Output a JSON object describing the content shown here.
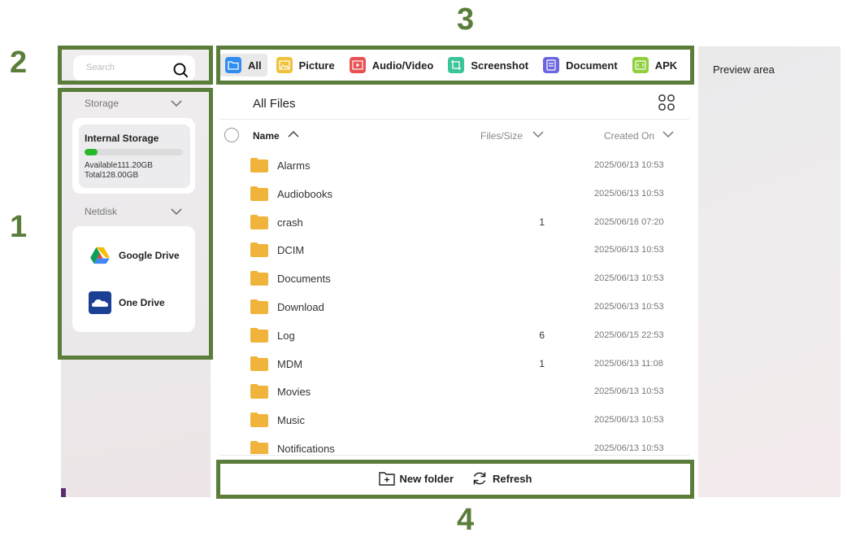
{
  "callouts": {
    "n1": "1",
    "n2": "2",
    "n3": "3",
    "n4": "4"
  },
  "search": {
    "placeholder": "Search"
  },
  "sidebar": {
    "storage_header": "Storage",
    "storage": {
      "name": "Internal Storage",
      "used_fraction": 0.13,
      "available": "Available111.20GB",
      "total": "Total128.00GB"
    },
    "netdisk_header": "Netdisk",
    "netdisks": [
      {
        "label": "Google Drive",
        "icon": "google-drive-icon"
      },
      {
        "label": "One Drive",
        "icon": "onedrive-icon"
      }
    ]
  },
  "tabs": [
    {
      "label": "All",
      "icon": "folder-icon",
      "color": "#2f8cf0",
      "active": true
    },
    {
      "label": "Picture",
      "icon": "picture-icon",
      "color": "#f0c23a",
      "active": false
    },
    {
      "label": "Audio/Video",
      "icon": "video-icon",
      "color": "#e95252",
      "active": false
    },
    {
      "label": "Screenshot",
      "icon": "screenshot-icon",
      "color": "#3cc49a",
      "active": false
    },
    {
      "label": "Document",
      "icon": "document-icon",
      "color": "#6b66e0",
      "active": false
    },
    {
      "label": "APK",
      "icon": "apk-icon",
      "color": "#8fcf3a",
      "active": false
    }
  ],
  "main": {
    "title": "All Files",
    "columns": {
      "name": "Name",
      "size": "Files/Size",
      "date": "Created On"
    },
    "files": [
      {
        "name": "Alarms",
        "count": "",
        "date": "2025/06/13 10:53"
      },
      {
        "name": "Audiobooks",
        "count": "",
        "date": "2025/06/13 10:53"
      },
      {
        "name": "crash",
        "count": "1",
        "date": "2025/06/16 07:20"
      },
      {
        "name": "DCIM",
        "count": "",
        "date": "2025/06/13 10:53"
      },
      {
        "name": "Documents",
        "count": "",
        "date": "2025/06/13 10:53"
      },
      {
        "name": "Download",
        "count": "",
        "date": "2025/06/13 10:53"
      },
      {
        "name": "Log",
        "count": "6",
        "date": "2025/06/15 22:53"
      },
      {
        "name": "MDM",
        "count": "1",
        "date": "2025/06/13 11:08"
      },
      {
        "name": "Movies",
        "count": "",
        "date": "2025/06/13 10:53"
      },
      {
        "name": "Music",
        "count": "",
        "date": "2025/06/13 10:53"
      },
      {
        "name": "Notifications",
        "count": "",
        "date": "2025/06/13 10:53"
      }
    ]
  },
  "bottom": {
    "new_folder": "New folder",
    "refresh": "Refresh"
  },
  "preview": {
    "label": "Preview area"
  },
  "colors": {
    "annotation_green": "#5a7d3a",
    "folder": "#f0b43c",
    "storage_fill": "#27b82a"
  }
}
